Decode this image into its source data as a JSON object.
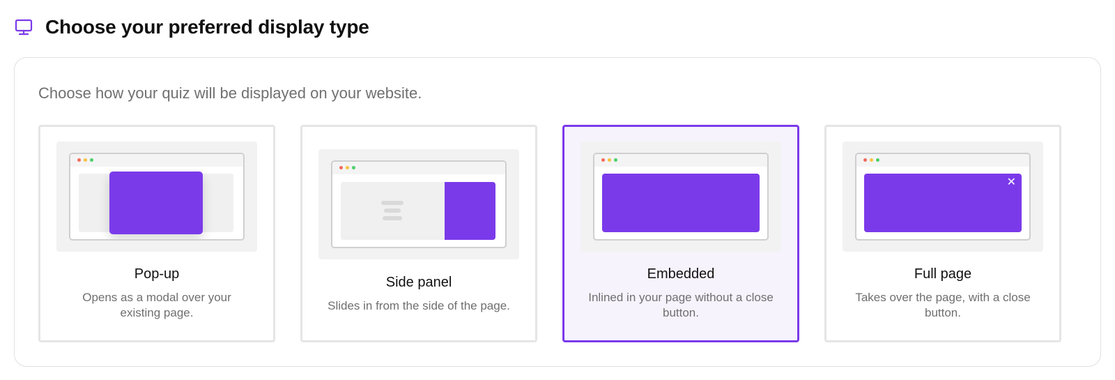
{
  "header": {
    "title": "Choose your preferred display type",
    "icon": "monitor-icon"
  },
  "panel": {
    "subtitle": "Choose how your quiz will be displayed on your website."
  },
  "options": [
    {
      "title": "Pop-up",
      "description": "Opens as a modal over your existing page.",
      "selected": false
    },
    {
      "title": "Side panel",
      "description": "Slides in from the side of the page.",
      "selected": false
    },
    {
      "title": "Embedded",
      "description": "Inlined in your page without a close button.",
      "selected": true
    },
    {
      "title": "Full page",
      "description": "Takes over the page, with a close button.",
      "selected": false
    }
  ],
  "colors": {
    "accent": "#7b3aea",
    "selected_bg": "#f6f3fd",
    "border": "#e5e5e5",
    "muted_text": "#707070"
  }
}
